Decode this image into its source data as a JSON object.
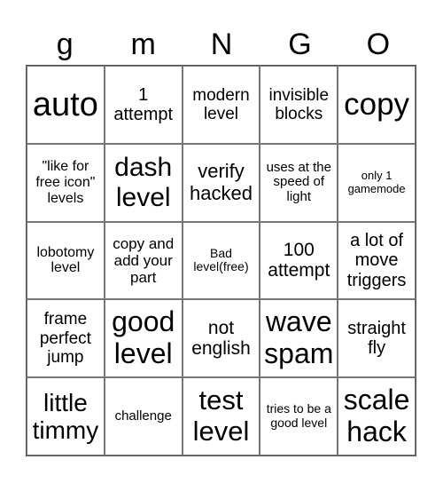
{
  "header": [
    "g",
    "m",
    "N",
    "G",
    "O"
  ],
  "cells": [
    "auto",
    "1 attempt",
    "modern level",
    "invisible blocks",
    "copy",
    "\"like for free icon\" levels",
    "dash level",
    "verify hacked",
    "uses at the speed of light",
    "only 1 gamemode",
    "lobotomy level",
    "copy and add your part",
    "Bad level(free)",
    "100 attempt",
    "a lot of move triggers",
    "frame perfect jump",
    "good level",
    "not english",
    "wave spam",
    "straight fly",
    "little timmy",
    "challenge",
    "test level",
    "tries to be a good level",
    "scale hack"
  ]
}
